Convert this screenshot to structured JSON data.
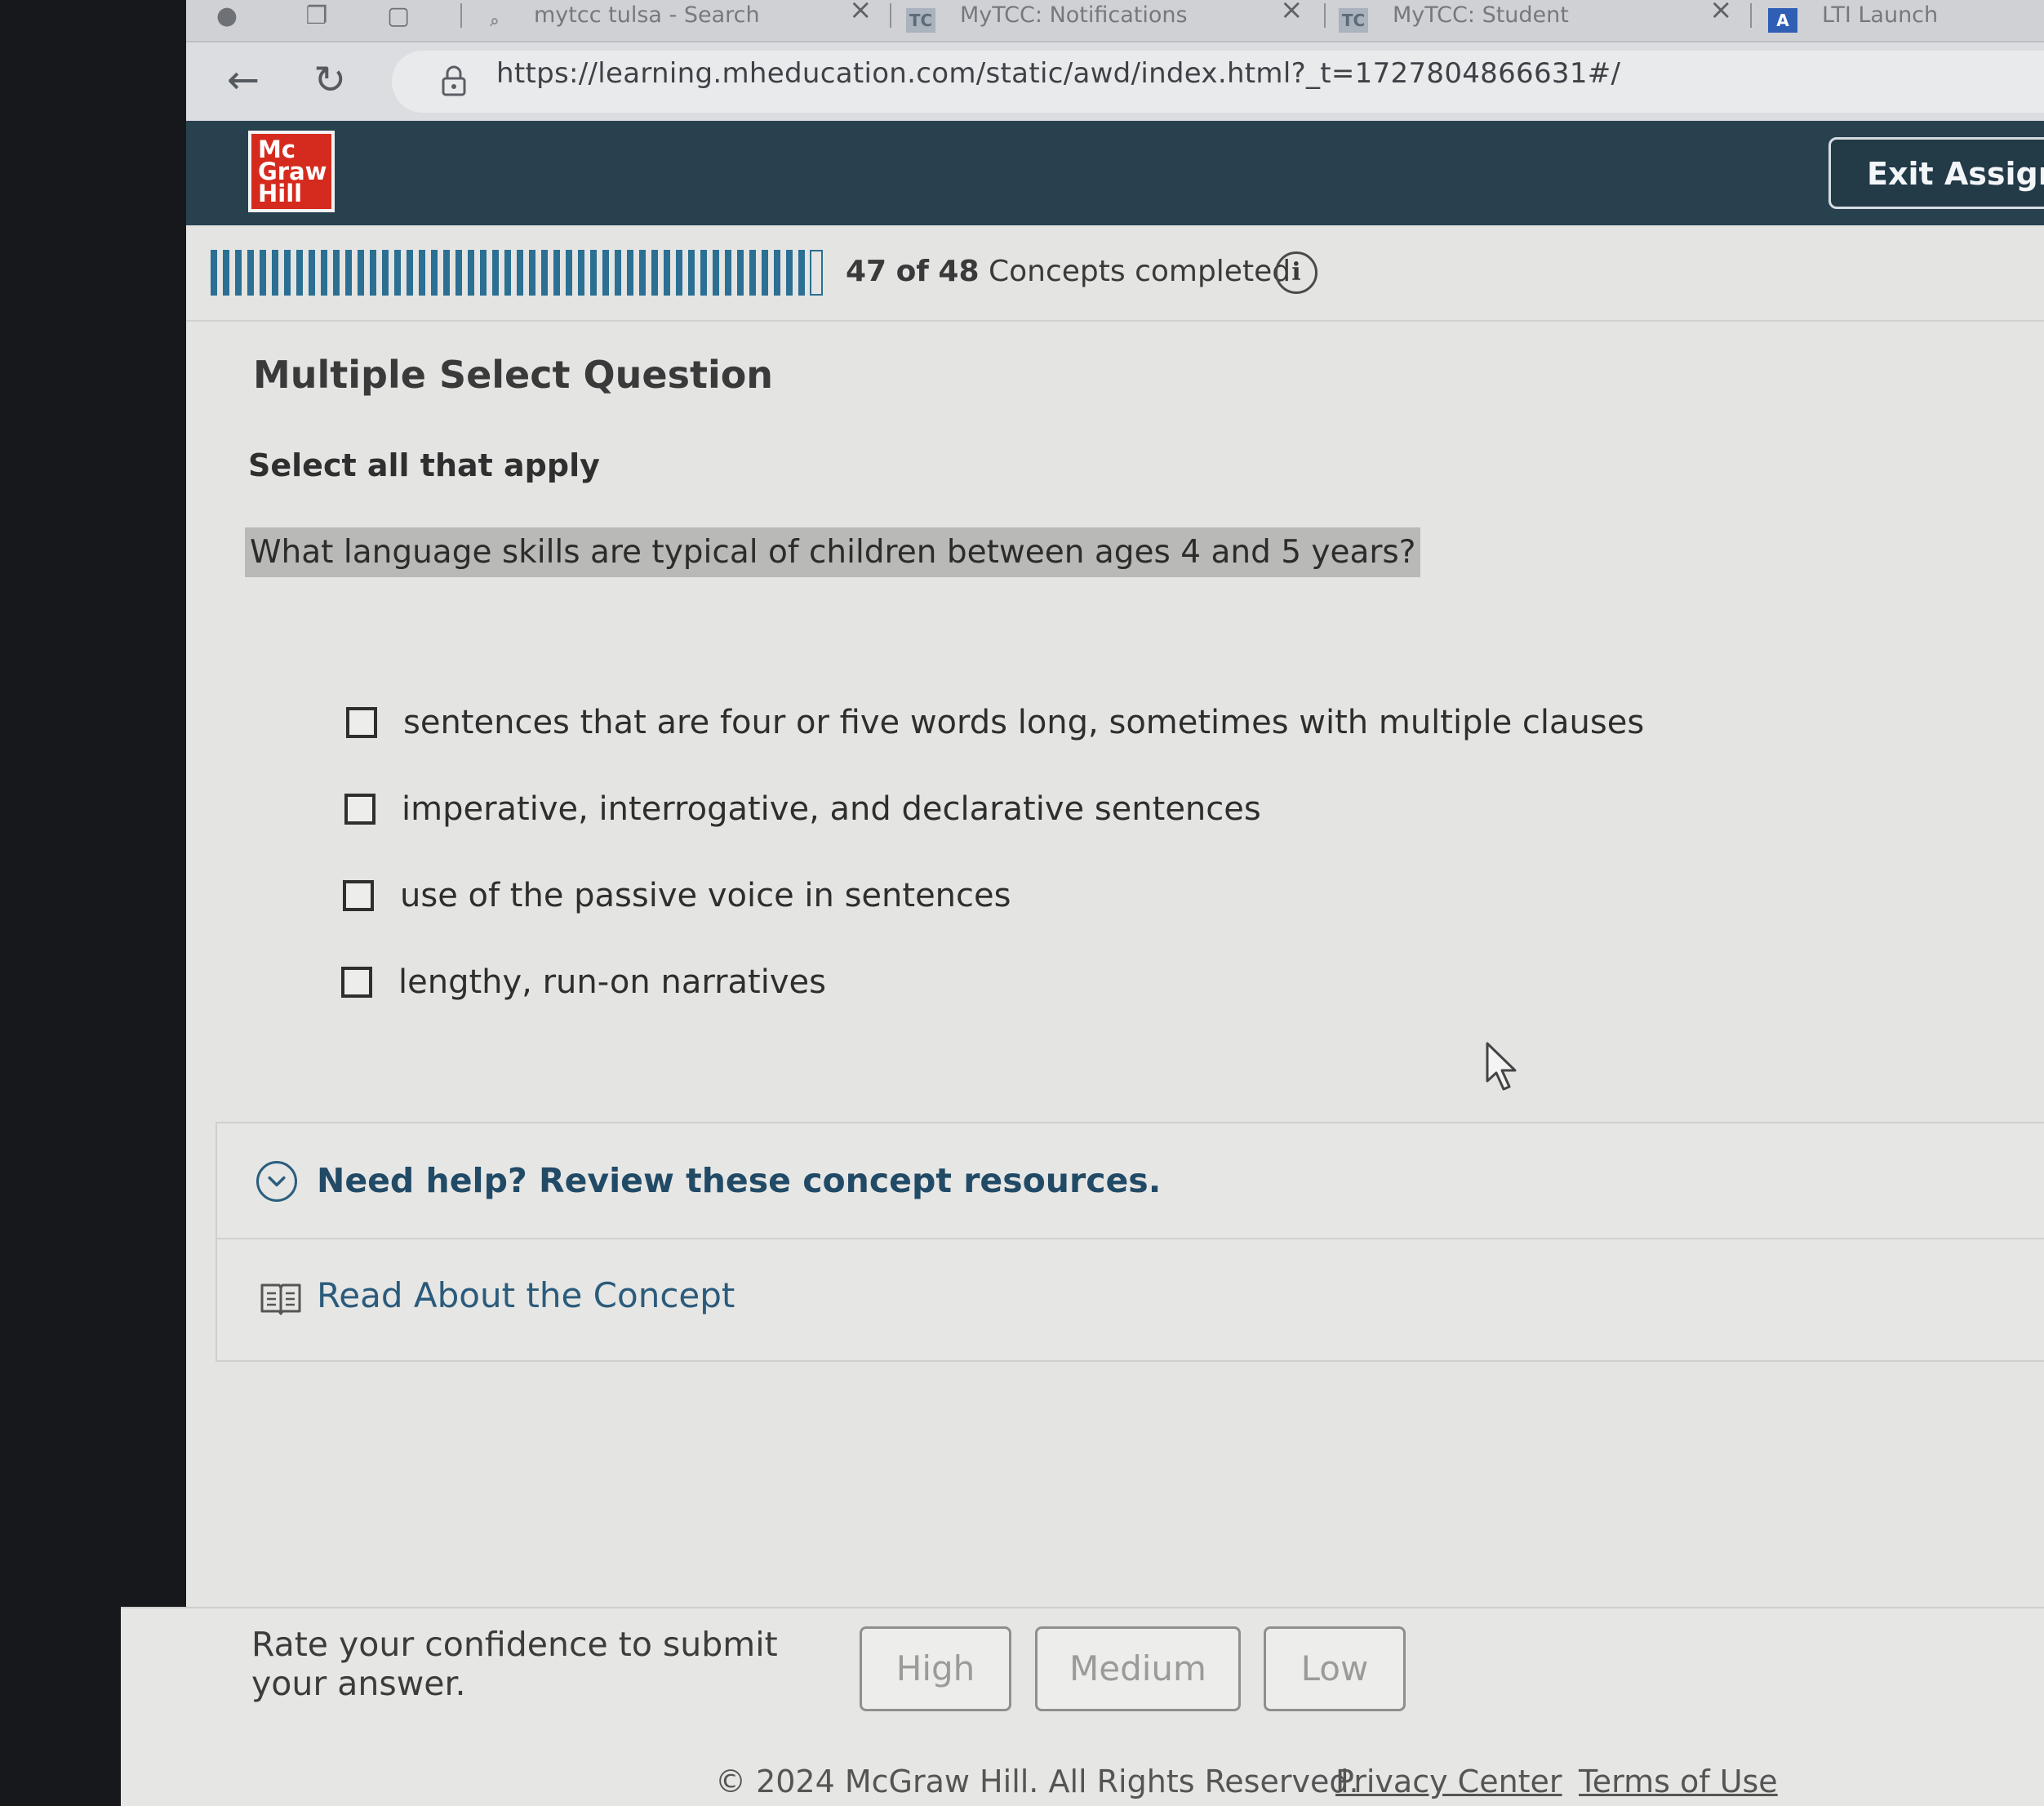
{
  "browser": {
    "tabs": [
      {
        "title": "mytcc tulsa - Search",
        "favicon": "search-icon"
      },
      {
        "title": "MyTCC: Notifications",
        "favicon": "TC"
      },
      {
        "title": "MyTCC: Student",
        "favicon": "TC"
      },
      {
        "title": "LTI Launch",
        "favicon": "A"
      }
    ],
    "tab_close": "×",
    "url": "https://learning.mheducation.com/static/awd/index.html?_t=1727804866631#/"
  },
  "header": {
    "logo_lines": [
      "Mc",
      "Graw",
      "Hill"
    ],
    "exit_label": "Exit Assignment",
    "brand_color": "#d52b1e",
    "header_color": "#28414f"
  },
  "progress": {
    "completed": "47",
    "total": "48",
    "of_text": "of",
    "suffix": "Concepts completed",
    "fraction": 0.979,
    "info_glyph": "i"
  },
  "question": {
    "type": "Multiple Select Question",
    "instruction": "Select all that apply",
    "prompt": "What language skills are typical of children between ages 4 and 5 years?",
    "options": [
      "sentences that are four or five words long, sometimes with multiple clauses",
      "imperative, interrogative, and declarative sentences",
      "use of the passive voice in sentences",
      "lengthy, run-on narratives"
    ]
  },
  "help": {
    "title": "Need help? Review these concept resources.",
    "resource": "Read About the Concept"
  },
  "confidence": {
    "label": "Rate your confidence to submit your answer.",
    "high": "High",
    "medium": "Medium",
    "low": "Low"
  },
  "footer": {
    "copyright": "© 2024 McGraw Hill. All Rights Reserved.",
    "privacy": "Privacy Center",
    "terms": "Terms of Use"
  }
}
